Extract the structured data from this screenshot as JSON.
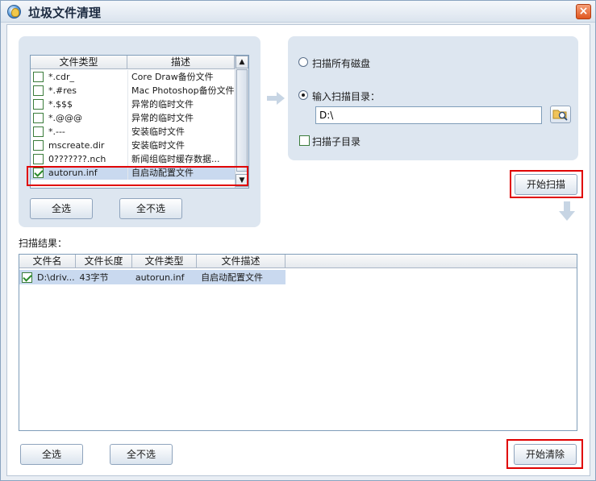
{
  "window": {
    "title": "垃圾文件清理",
    "close_glyph": "×",
    "icon": "app-icon"
  },
  "filetypes": {
    "headers": [
      "文件类型",
      "描述"
    ],
    "rows": [
      {
        "type": "*.cdr_",
        "desc": "Core Draw备份文件",
        "checked": false
      },
      {
        "type": "*.#res",
        "desc": "Mac Photoshop备份文件",
        "checked": false
      },
      {
        "type": "*.$$$",
        "desc": "异常的临时文件",
        "checked": false
      },
      {
        "type": "*.@@@",
        "desc": "异常的临时文件",
        "checked": false
      },
      {
        "type": "*.---",
        "desc": "安装临时文件",
        "checked": false
      },
      {
        "type": "mscreate.dir",
        "desc": "安装临时文件",
        "checked": false
      },
      {
        "type": "0???????.nch",
        "desc": "新闻组临时缓存数据...",
        "checked": false
      },
      {
        "type": "autorun.inf",
        "desc": "自启动配置文件",
        "checked": true
      }
    ],
    "select_all": "全选",
    "deselect_all": "全不选"
  },
  "scan_options": {
    "all_disks_label": "扫描所有磁盘",
    "input_dir_label": "输入扫描目录：",
    "dir_value": "D:\\",
    "subdir_label": "扫描子目录",
    "selected_option": "input_dir",
    "include_subdirs": false
  },
  "scan_button": "开始扫描",
  "results": {
    "title": "扫描结果：",
    "headers": [
      "文件名",
      "文件长度",
      "文件类型",
      "文件描述"
    ],
    "rows": [
      {
        "name": "D:\\driv...",
        "size": "43字节",
        "type": "autorun.inf",
        "desc": "自启动配置文件",
        "checked": true
      }
    ],
    "select_all": "全选",
    "deselect_all": "全不选"
  },
  "clean_button": "开始清除",
  "colors": {
    "highlight_box": "#e00000",
    "panel_bg": "#dde6f0",
    "selection_bg": "#c9d9ef"
  }
}
